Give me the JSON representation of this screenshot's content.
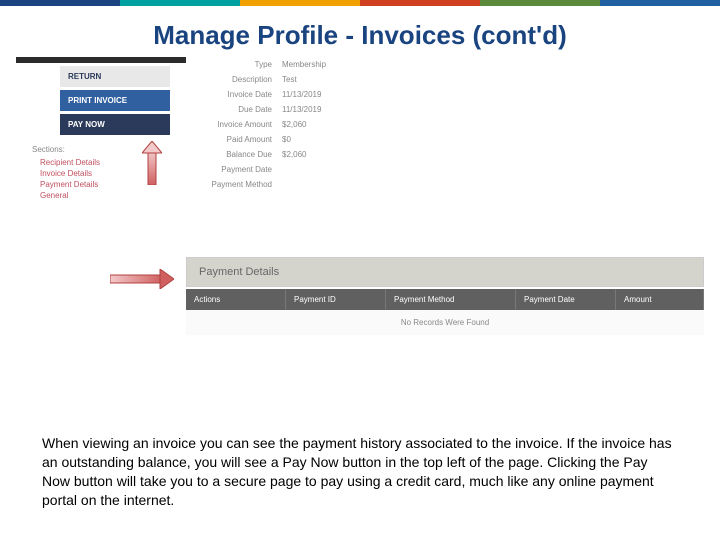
{
  "title": "Manage Profile  - Invoices (cont'd)",
  "buttons": {
    "return": "RETURN",
    "print": "PRINT INVOICE",
    "paynow": "PAY NOW"
  },
  "sections": {
    "label": "Sections:",
    "items": [
      "Recipient Details",
      "Invoice Details",
      "Payment Details",
      "General"
    ]
  },
  "details": [
    {
      "label": "Type",
      "value": "Membership"
    },
    {
      "label": "Description",
      "value": "Test"
    },
    {
      "label": "Invoice Date",
      "value": "11/13/2019"
    },
    {
      "label": "Due Date",
      "value": "11/13/2019"
    },
    {
      "label": "Invoice Amount",
      "value": "$2,060"
    },
    {
      "label": "Paid Amount",
      "value": "$0"
    },
    {
      "label": "Balance Due",
      "value": "$2,060"
    },
    {
      "label": "Payment Date",
      "value": ""
    },
    {
      "label": "Payment Method",
      "value": ""
    }
  ],
  "payment_details_header": "Payment Details",
  "table": {
    "headers": [
      "Actions",
      "Payment ID",
      "Payment Method",
      "Payment Date",
      "Amount"
    ],
    "empty": "No Records Were Found"
  },
  "caption": "When viewing an invoice you can see the payment history associated to the invoice.  If the invoice has an outstanding balance, you will see a Pay Now button in the top left of the page.  Clicking the Pay Now button will take you to a secure page to pay using a credit card, much like any online payment portal on the internet."
}
